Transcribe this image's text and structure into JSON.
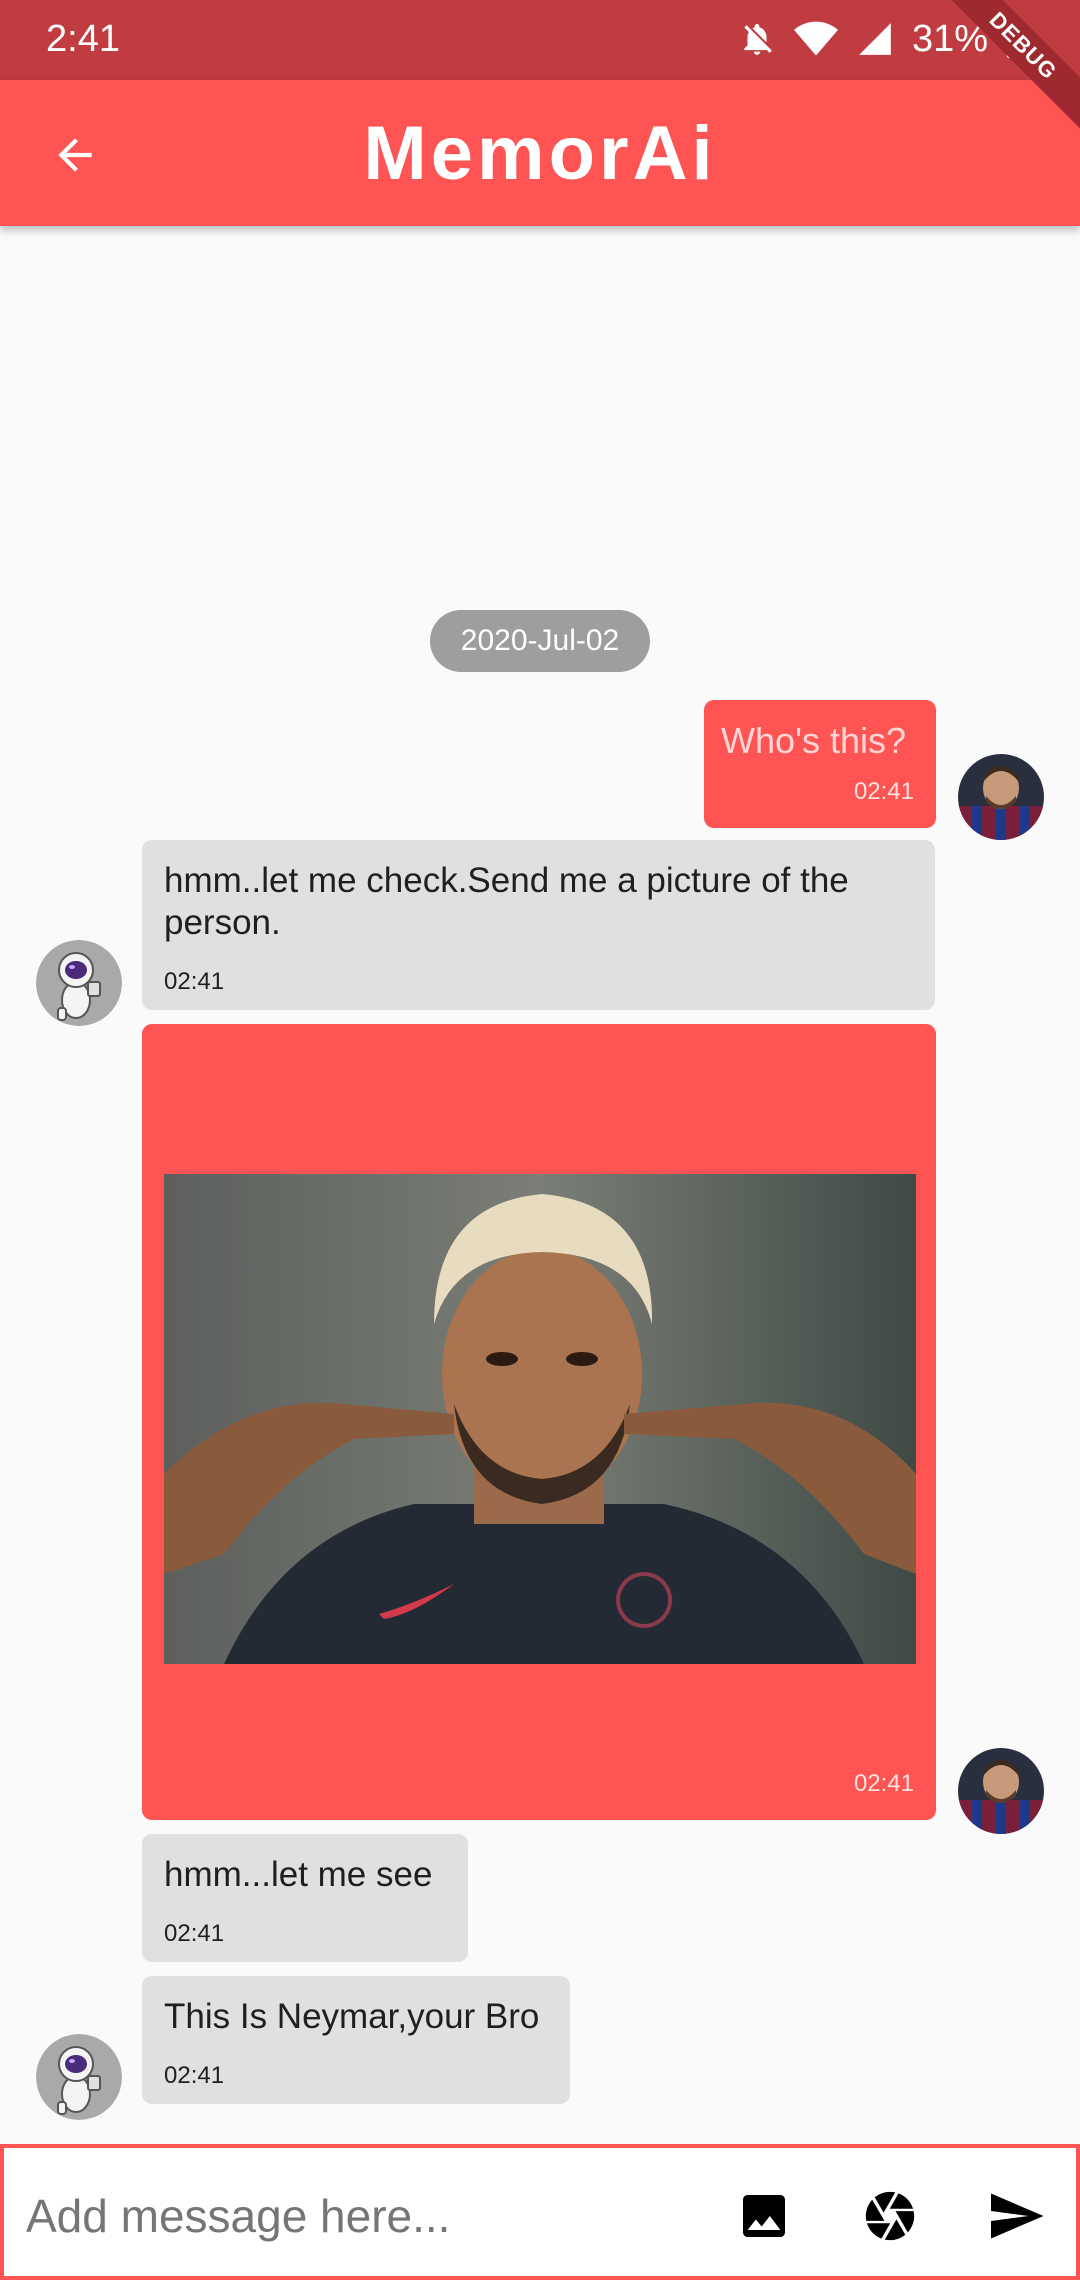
{
  "status_bar": {
    "time": "2:41",
    "battery": "31%",
    "icons": [
      "notifications-off-icon",
      "wifi-icon",
      "signal-icon",
      "battery-icon"
    ],
    "debug_banner": "DEBUG"
  },
  "app_bar": {
    "title": "MemorAi",
    "back_icon": "arrow-back-icon",
    "color": "#fe5454"
  },
  "chat": {
    "date_separator": "2020-Jul-02",
    "messages": [
      {
        "sender": "user",
        "text": "Who's this?",
        "time": "02:41"
      },
      {
        "sender": "bot",
        "text": "hmm..let me check.Send me a picture of the person.",
        "time": "02:41"
      },
      {
        "sender": "user",
        "type": "image",
        "image_alt": "photo of a footballer in a dark PSG shirt pointing at his cheeks",
        "time": "02:41"
      },
      {
        "sender": "bot",
        "text": "hmm...let me see",
        "time": "02:41"
      },
      {
        "sender": "bot",
        "text": "This Is Neymar,your Bro",
        "time": "02:41"
      }
    ]
  },
  "input": {
    "placeholder": "Add message here...",
    "value": "",
    "buttons": [
      "image-icon",
      "camera-shutter-icon",
      "send-icon"
    ]
  }
}
